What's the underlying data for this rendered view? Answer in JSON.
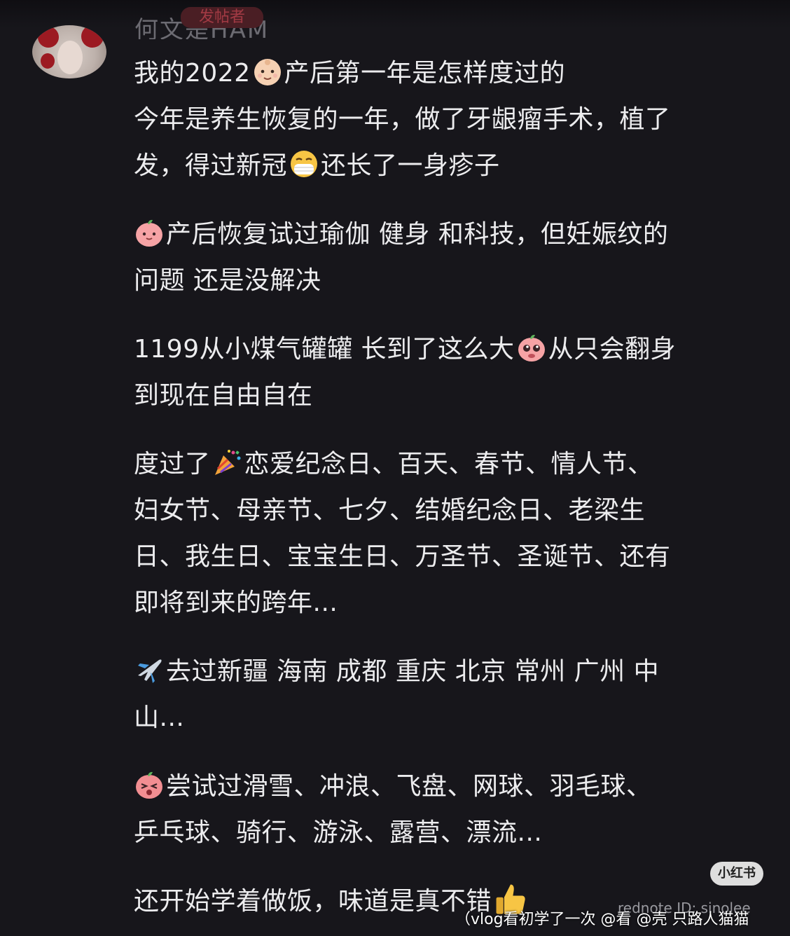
{
  "author": {
    "name": "何文是HAM",
    "tag": "发帖者"
  },
  "post": {
    "title": "我的2022",
    "title_after": "产后第一年是怎样度过的",
    "p1_l1": "今年是养生恢复的一年，做了牙龈瘤手术，植了",
    "p1_l2a": "发，得过新冠",
    "p1_l2b": "还长了一身疹子",
    "p2_l1": "产后恢复试过瑜伽 健身 和科技，但妊娠纹的",
    "p2_l2": "问题 还是没解决",
    "p3_l1a": "1199从小煤气罐罐 长到了这么大",
    "p3_l1b": "从只会翻身",
    "p3_l2": "到现在自由自在",
    "p4_l1a": "度过了",
    "p4_l1b": "恋爱纪念日、百天、春节、情人节、",
    "p4_l2": "妇女节、母亲节、七夕、结婚纪念日、老梁生",
    "p4_l3": "日、我生日、宝宝生日、万圣节、圣诞节、还有",
    "p4_l4": "即将到来的跨年...",
    "p5_l1": "去过新疆 海南 成都 重庆 北京 常州 广州 中",
    "p5_l2": "山...",
    "p6_l1": "尝试过滑雪、冲浪、飞盘、网球、羽毛球、",
    "p6_l2": "乒乓球、骑行、游泳、露营、漂流...",
    "p7_l1": "还开始学着做饭，味道是真不错"
  },
  "icons": {
    "baby": "baby-face-icon",
    "mask": "face-with-mask-icon",
    "peach1": "peach-face-icon",
    "pleading": "pleading-peach-icon",
    "party": "party-popper-icon",
    "airplane": "airplane-icon",
    "peach2": "surprised-peach-icon",
    "thumbs": "thumbs-up-icon"
  },
  "overlay": {
    "logo": "小红书",
    "watermark": "rednote ID: sinolee",
    "caption": "（vlog看初学了一次 @看 @壳 只路人猫猫"
  },
  "colors": {
    "background": "#17161b",
    "text": "#ececee",
    "tag_bg": "#4a1e24"
  }
}
